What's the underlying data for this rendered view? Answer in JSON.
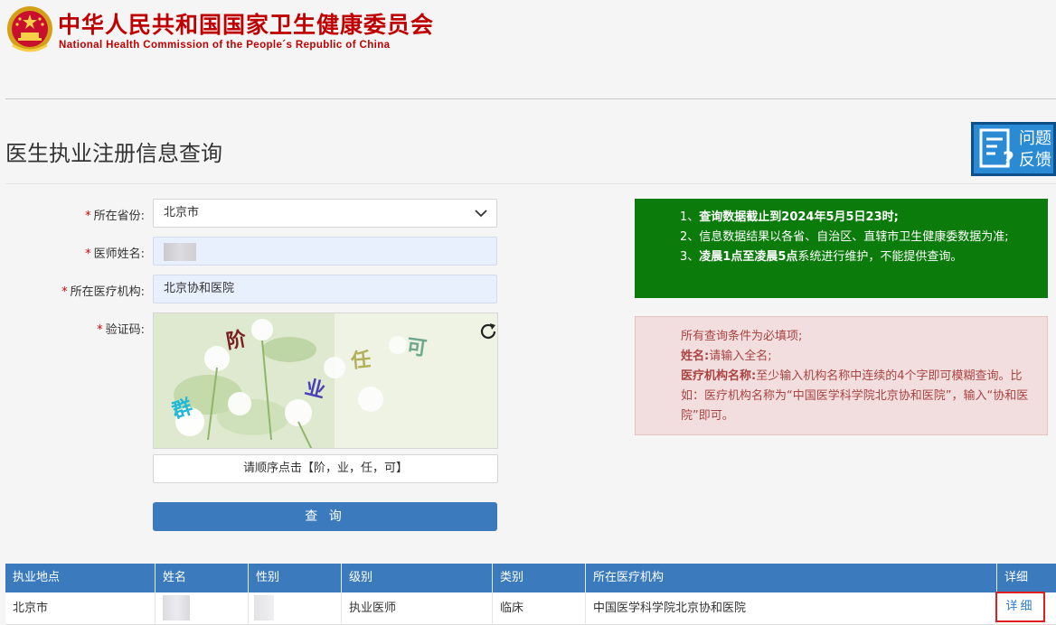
{
  "header": {
    "title_cn": "中华人民共和国国家卫生健康委员会",
    "title_en": "National Health Commission of the People´s Republic of China"
  },
  "page": {
    "title": "医生执业注册信息查询",
    "feedback": {
      "line1": "问题",
      "line2": "反馈"
    }
  },
  "form": {
    "province": {
      "label": "所在省份:",
      "value": "北京市"
    },
    "name": {
      "label": "医师姓名:",
      "value": ""
    },
    "institution": {
      "label": "所在医疗机构:",
      "value": "北京协和医院"
    },
    "captcha": {
      "label": "验证码:",
      "chars": [
        "阶",
        "可",
        "任",
        "业",
        "群"
      ],
      "hint": "请顺序点击【阶，业，任，可】"
    },
    "submit_label": "查 询"
  },
  "notice_green": {
    "line1_prefix": "1、",
    "line1_bold": "查询数据截止到2024年5月5日23时;",
    "line2": "2、信息数据结果以各省、自治区、直辖市卫生健康委数据为准;",
    "line3_prefix": "3、",
    "line3_bold": "凌晨1点至凌晨5点",
    "line3_rest": "系统进行维护，不能提供查询。"
  },
  "notice_pink": {
    "line1": "所有查询条件为必填项;",
    "name_label": "姓名:",
    "name_text": "请输入全名;",
    "org_label": "医疗机构名称:",
    "org_text": "至少输入机构名称中连续的4个字即可模糊查询。比如：医疗机构名称为“中国医学科学院北京协和医院”，输入“协和医院”即可。"
  },
  "table": {
    "headers": [
      "执业地点",
      "姓名",
      "性别",
      "级别",
      "类别",
      "所在医疗机构",
      "详细"
    ],
    "rows": [
      {
        "location": "北京市",
        "name": "",
        "gender": "",
        "level": "执业医师",
        "category": "临床",
        "institution": "中国医学科学院北京协和医院",
        "detail": "详细"
      }
    ]
  },
  "colors": {
    "brand_red": "#c00000",
    "primary_blue": "#3b7bbd",
    "notice_green": "#0b7b0b",
    "notice_pink_bg": "#f2dede",
    "highlight_red": "#e02020"
  }
}
